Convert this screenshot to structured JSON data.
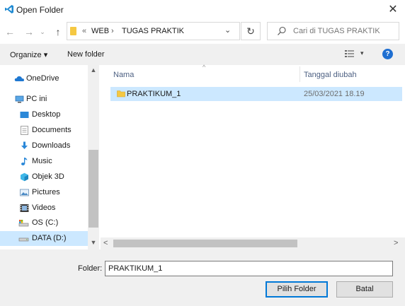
{
  "window": {
    "title": "Open Folder",
    "close_glyph": "✕"
  },
  "nav": {
    "back_glyph": "←",
    "forward_glyph": "→",
    "recent_glyph": "⌄",
    "up_glyph": "↑",
    "refresh_glyph": "↻"
  },
  "address": {
    "overflow_glyph": "«",
    "crumbs": [
      "WEB",
      "TUGAS PRAKTIK"
    ],
    "separator": "›",
    "dropdown_glyph": "⌄"
  },
  "search": {
    "placeholder": "Cari di TUGAS PRAKTIK",
    "value": ""
  },
  "toolbar": {
    "organize_label": "Organize ▾",
    "new_folder_label": "New folder",
    "view_dropdown_glyph": "▾",
    "help_glyph": "?"
  },
  "sidebar": {
    "items": [
      {
        "label": "OneDrive",
        "icon": "cloud-icon"
      },
      {
        "label": "PC ini",
        "icon": "computer-icon"
      },
      {
        "label": "Desktop",
        "icon": "desktop-icon"
      },
      {
        "label": "Documents",
        "icon": "documents-icon"
      },
      {
        "label": "Downloads",
        "icon": "download-icon"
      },
      {
        "label": "Music",
        "icon": "music-icon"
      },
      {
        "label": "Objek 3D",
        "icon": "3d-object-icon"
      },
      {
        "label": "Pictures",
        "icon": "pictures-icon"
      },
      {
        "label": "Videos",
        "icon": "videos-icon"
      },
      {
        "label": "OS (C:)",
        "icon": "drive-icon"
      },
      {
        "label": "DATA (D:)",
        "icon": "drive-icon",
        "selected": true
      }
    ],
    "scroll_up_glyph": "▲",
    "scroll_down_glyph": "▼"
  },
  "file_list": {
    "columns": [
      "Nama",
      "Tanggal diubah"
    ],
    "sort_glyph": "^",
    "rows": [
      {
        "name": "PRAKTIKUM_1",
        "date": "25/03/2021 18.19"
      }
    ],
    "scroll_left_glyph": "<",
    "scroll_right_glyph": ">"
  },
  "footer": {
    "folder_label": "Folder:",
    "folder_value": "PRAKTIKUM_1",
    "select_label": "Pilih Folder",
    "cancel_label": "Batal"
  },
  "colors": {
    "selection": "#cce8ff",
    "accent": "#0078d7",
    "folder": "#f5c842"
  }
}
